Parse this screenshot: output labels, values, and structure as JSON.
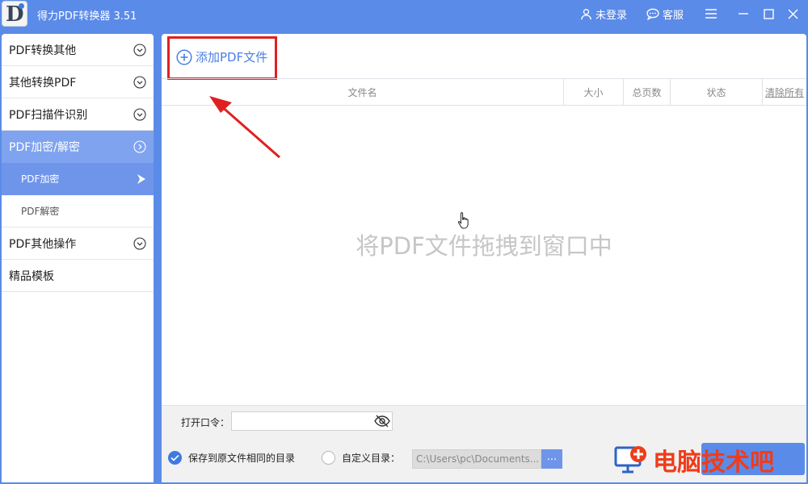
{
  "app": {
    "title": "得力PDF转换器 3.51",
    "logo_letter": "D"
  },
  "titlebar": {
    "login": "未登录",
    "service": "客服"
  },
  "sidebar": {
    "items": [
      {
        "label": "PDF转换其他"
      },
      {
        "label": "其他转换PDF"
      },
      {
        "label": "PDF扫描件识别"
      },
      {
        "label": "PDF加密/解密"
      },
      {
        "label": "PDF其他操作"
      },
      {
        "label": "精品模板"
      }
    ],
    "subitems": [
      {
        "label": "PDF加密"
      },
      {
        "label": "PDF解密"
      }
    ]
  },
  "main": {
    "add_label": "添加PDF文件",
    "columns": {
      "name": "文件名",
      "size": "大小",
      "pages": "总页数",
      "status": "状态",
      "clear": "清除所有"
    },
    "drop_hint": "将PDF文件拖拽到窗口中"
  },
  "bottom": {
    "password_label": "打开口令：",
    "password_value": "",
    "save_same_label": "保存到原文件相同的目录",
    "custom_dir_label": "自定义目录：",
    "custom_dir_path": "C:\\Users\\pc\\Documents...",
    "browse_label": "..."
  },
  "watermark": {
    "text": "电脑技术吧"
  },
  "colors": {
    "accent": "#5b8be8",
    "highlight": "#e02020",
    "sidebar_active": "#7fa3ef"
  }
}
